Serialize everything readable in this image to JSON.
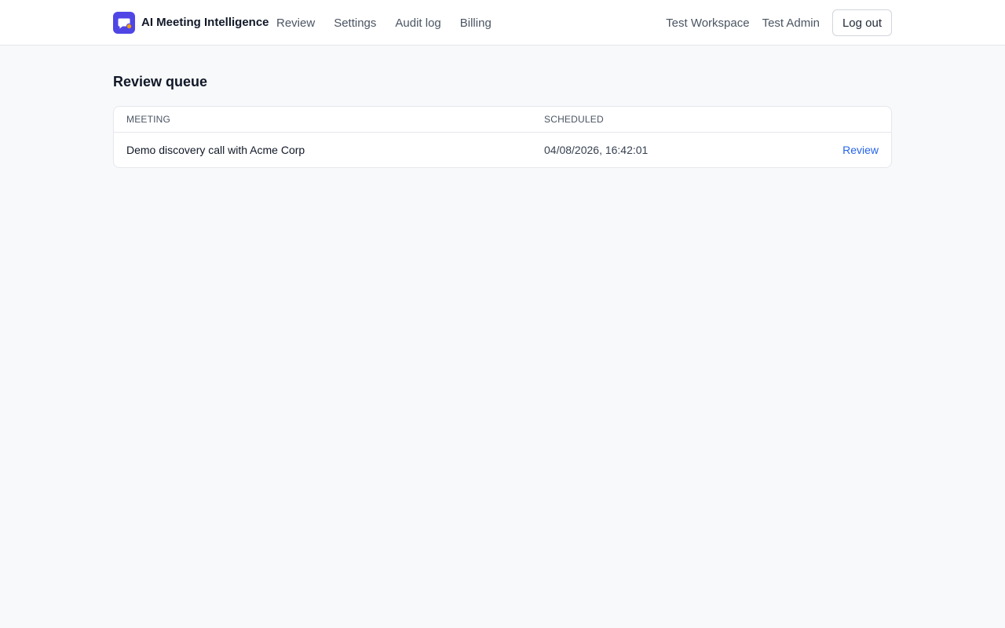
{
  "header": {
    "app_name": "AI Meeting Intelligence",
    "nav": [
      {
        "label": "Review"
      },
      {
        "label": "Settings"
      },
      {
        "label": "Audit log"
      },
      {
        "label": "Billing"
      }
    ],
    "workspace": "Test Workspace",
    "user": "Test Admin",
    "logout_label": "Log out",
    "logo_icon": "chat-bubble-icon",
    "brand_color": "#4f46e5",
    "notification_dot_color": "#f59e0b"
  },
  "main": {
    "title": "Review queue",
    "table": {
      "columns": [
        "MEETING",
        "SCHEDULED"
      ],
      "rows": [
        {
          "meeting": "Demo discovery call with Acme Corp",
          "scheduled": "04/08/2026, 16:42:01",
          "action": "Review"
        }
      ]
    }
  },
  "colors": {
    "link": "#2563eb",
    "background": "#f8f9fb"
  }
}
